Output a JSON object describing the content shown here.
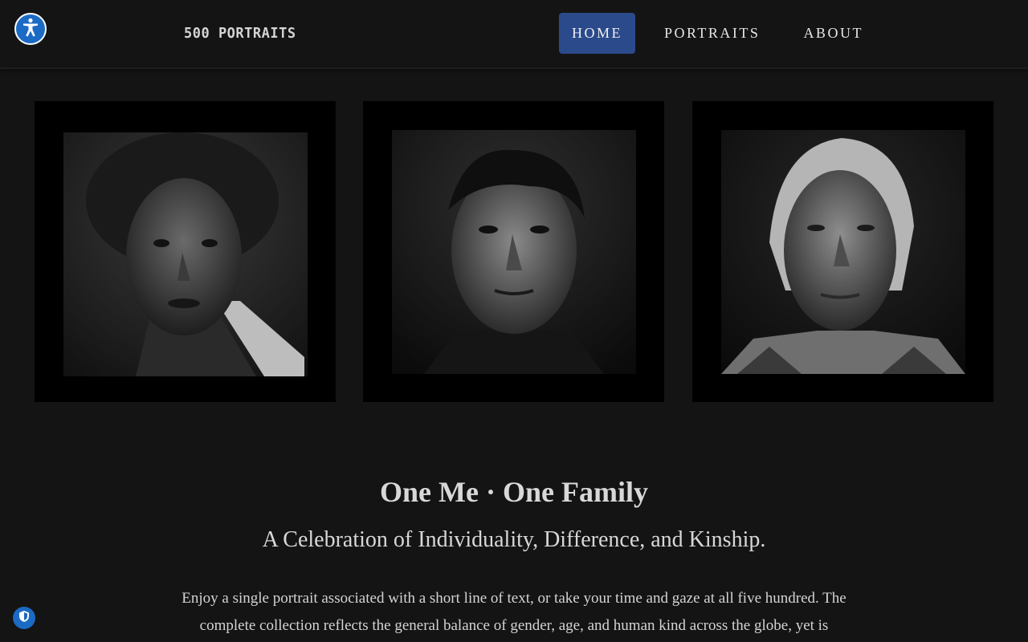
{
  "header": {
    "brand": "500 PORTRAITS",
    "nav": [
      {
        "label": "HOME",
        "active": true
      },
      {
        "label": "PORTRAITS",
        "active": false
      },
      {
        "label": "ABOUT",
        "active": false
      }
    ],
    "accent_color": "#2b4a8b"
  },
  "icons": {
    "accessibility": "accessibility-icon",
    "privacy": "shield-icon"
  },
  "portraits": [
    {
      "name": "portrait-woman"
    },
    {
      "name": "portrait-man"
    },
    {
      "name": "portrait-elder-woman"
    }
  ],
  "intro": {
    "title": "One Me · One Family",
    "subtitle": "A Celebration of Individuality, Difference, and Kinship.",
    "body": "Enjoy a single portrait associated with a short line of text, or take your time and gaze at all five hundred. The complete collection reflects the general balance of gender, age, and human kind across the globe, yet is"
  }
}
